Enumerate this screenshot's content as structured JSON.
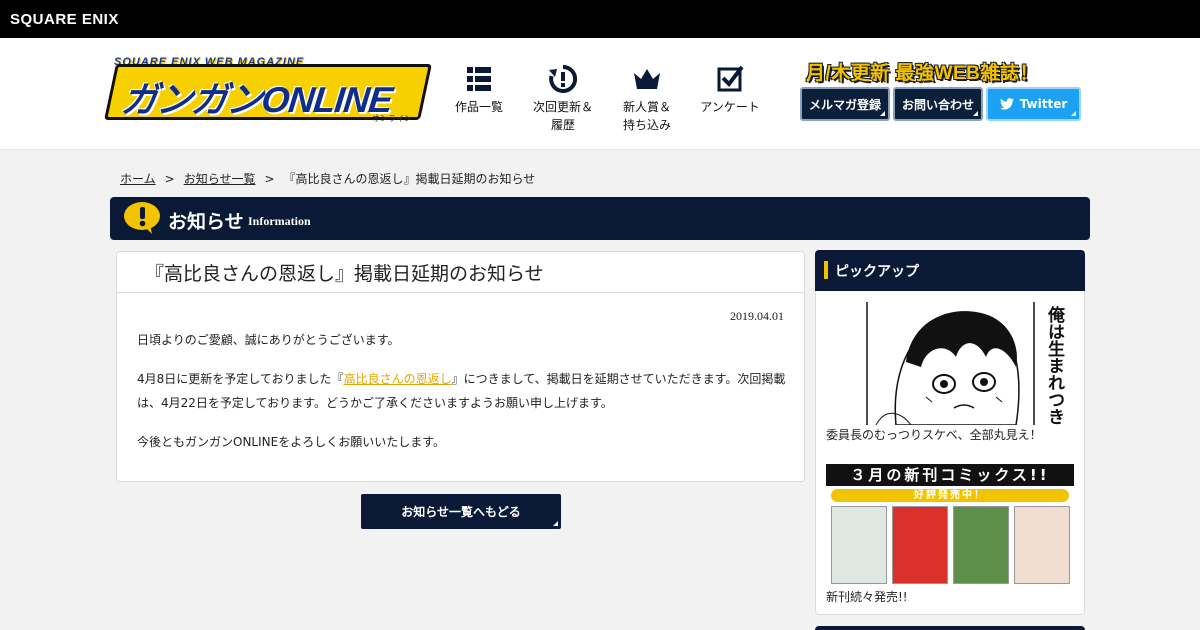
{
  "topbar": {
    "corp_logo": "SQUARE ENIX"
  },
  "header": {
    "logo_top": "SQUARE ENIX WEB MAGAZINE",
    "logo_main": "ガンガンONLINE",
    "logo_sub": "オンライン",
    "nav": [
      {
        "label_line1": "作品一覧",
        "label_line2": "",
        "icon": "grid-list-icon"
      },
      {
        "label_line1": "次回更新＆",
        "label_line2": "履歴",
        "icon": "update-clock-icon"
      },
      {
        "label_line1": "新人賞＆",
        "label_line2": "持ち込み",
        "icon": "crown-icon"
      },
      {
        "label_line1": "アンケート",
        "label_line2": "",
        "icon": "checkbox-icon"
      }
    ],
    "tagline": "月/木更新 最強WEB雑誌！",
    "buttons": {
      "mail": "メルマガ登録",
      "contact": "お問い合わせ",
      "twitter": "Twitter"
    },
    "colors": {
      "navy": "#0a1a36",
      "yellow": "#f2c400",
      "twitter": "#1da1f2"
    }
  },
  "breadcrumb": {
    "home": "ホーム",
    "sep": ">",
    "list": "お知らせ一覧",
    "current": "『高比良さんの恩返し』掲載日延期のお知らせ"
  },
  "section": {
    "title": "お知らせ",
    "title_en": "Information"
  },
  "article": {
    "title": "『高比良さんの恩返し』掲載日延期のお知らせ",
    "date": "2019.04.01",
    "p1": "日頃よりのご愛顧、誠にありがとうございます。",
    "p2_before": "4月8日に更新を予定しておりました『",
    "p2_link": "高比良さんの恩返し",
    "p2_after": "』につきまして、掲載日を延期させていただきます。次回掲載は、4月22日を予定しております。どうかご了承くださいますようお願い申し上げます。",
    "p3": "今後ともガンガンONLINEをよろしくお願いいたします。"
  },
  "back_button": "お知らせ一覧へもどる",
  "sidebar": {
    "title": "ピックアップ",
    "pick1": {
      "vertical_text": "俺は生まれつき",
      "caption": "委員長のむっつりスケベ、全部丸見え！"
    },
    "pick2": {
      "banner_title": "３月の新刊コミックス!!",
      "banner_sub": "好評発売中！",
      "caption": "新刊続々発売!!"
    }
  }
}
